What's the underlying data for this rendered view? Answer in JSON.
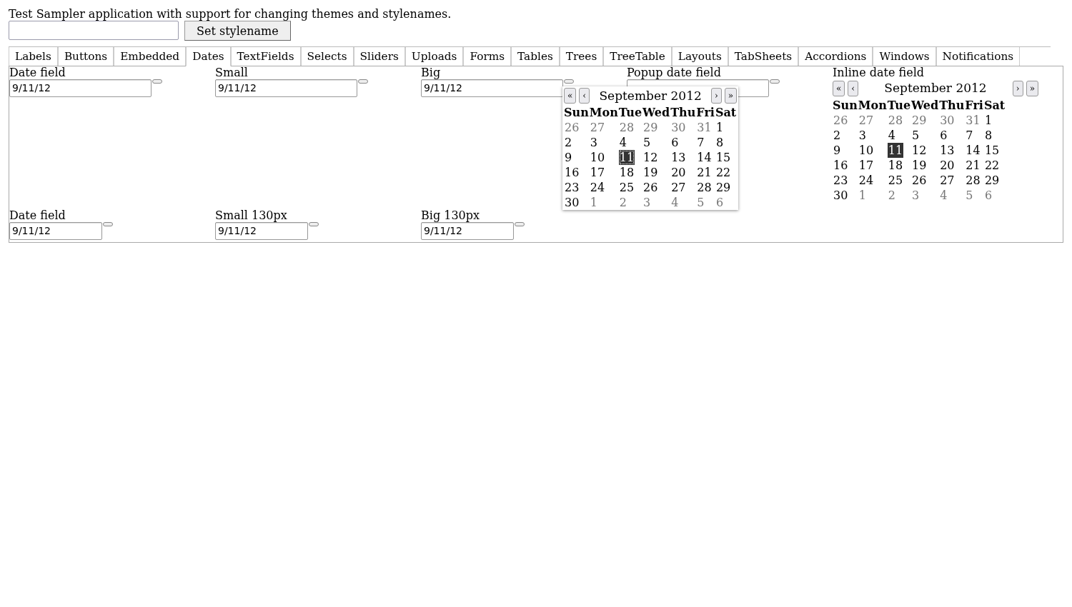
{
  "header": {
    "text": "Test Sampler application with support for changing themes and stylenames."
  },
  "stylename": {
    "button": "Set stylename"
  },
  "tabs": [
    {
      "label": "Labels",
      "selected": false
    },
    {
      "label": "Buttons",
      "selected": false
    },
    {
      "label": "Embedded",
      "selected": false
    },
    {
      "label": "Dates",
      "selected": true
    },
    {
      "label": "TextFields",
      "selected": false
    },
    {
      "label": "Selects",
      "selected": false
    },
    {
      "label": "Sliders",
      "selected": false
    },
    {
      "label": "Uploads",
      "selected": false
    },
    {
      "label": "Forms",
      "selected": false
    },
    {
      "label": "Tables",
      "selected": false
    },
    {
      "label": "Trees",
      "selected": false
    },
    {
      "label": "TreeTable",
      "selected": false
    },
    {
      "label": "Layouts",
      "selected": false
    },
    {
      "label": "TabSheets",
      "selected": false
    },
    {
      "label": "Accordions",
      "selected": false
    },
    {
      "label": "Windows",
      "selected": false
    },
    {
      "label": "Notifications",
      "selected": false
    }
  ],
  "rows": [
    {
      "fields": [
        {
          "label": "Date field",
          "value": "9/11/12",
          "kind": "wide"
        },
        {
          "label": "Small",
          "value": "9/11/12",
          "kind": "wide"
        },
        {
          "label": "Big",
          "value": "9/11/12",
          "kind": "wide"
        },
        {
          "label": "Popup date field",
          "kind": "wide"
        }
      ],
      "inline": {
        "label": "Inline date field",
        "calendar": {
          "title": "September 2012",
          "nav": [
            "«",
            "‹",
            "›",
            "»"
          ],
          "weekdays": [
            "Sun",
            "Mon",
            "Tue",
            "Wed",
            "Thu",
            "Fri",
            "Sat"
          ],
          "weeks": [
            [
              {
                "d": "26",
                "other": true
              },
              {
                "d": "27",
                "other": true
              },
              {
                "d": "28",
                "other": true
              },
              {
                "d": "29",
                "other": true
              },
              {
                "d": "30",
                "other": true
              },
              {
                "d": "31",
                "other": true
              },
              {
                "d": "1",
                "other": false
              }
            ],
            [
              {
                "d": "2",
                "other": false
              },
              {
                "d": "3",
                "other": false
              },
              {
                "d": "4",
                "other": false
              },
              {
                "d": "5",
                "other": false
              },
              {
                "d": "6",
                "other": false
              },
              {
                "d": "7",
                "other": false
              },
              {
                "d": "8",
                "other": false
              }
            ],
            [
              {
                "d": "9",
                "other": false
              },
              {
                "d": "10",
                "other": false
              },
              {
                "d": "11",
                "other": false,
                "selected": true
              },
              {
                "d": "12",
                "other": false
              },
              {
                "d": "13",
                "other": false
              },
              {
                "d": "14",
                "other": false
              },
              {
                "d": "15",
                "other": false
              }
            ],
            [
              {
                "d": "16",
                "other": false
              },
              {
                "d": "17",
                "other": false
              },
              {
                "d": "18",
                "other": false
              },
              {
                "d": "19",
                "other": false
              },
              {
                "d": "20",
                "other": false
              },
              {
                "d": "21",
                "other": false
              },
              {
                "d": "22",
                "other": false
              }
            ],
            [
              {
                "d": "23",
                "other": false
              },
              {
                "d": "24",
                "other": false
              },
              {
                "d": "25",
                "other": false
              },
              {
                "d": "26",
                "other": false
              },
              {
                "d": "27",
                "other": false
              },
              {
                "d": "28",
                "other": false
              },
              {
                "d": "29",
                "other": false
              }
            ],
            [
              {
                "d": "30",
                "other": false
              },
              {
                "d": "1",
                "other": true
              },
              {
                "d": "2",
                "other": true
              },
              {
                "d": "3",
                "other": true
              },
              {
                "d": "4",
                "other": true
              },
              {
                "d": "5",
                "other": true
              },
              {
                "d": "6",
                "other": true
              }
            ]
          ]
        }
      }
    },
    {
      "fields": [
        {
          "label": "Date field",
          "value": "9/11/12",
          "kind": "narrow"
        },
        {
          "label": "Small 130px",
          "value": "9/11/12",
          "kind": "narrow"
        },
        {
          "label": "Big 130px",
          "value": "9/11/12",
          "kind": "narrow"
        }
      ]
    }
  ],
  "popup": {
    "title": "September 2012",
    "nav": [
      "«",
      "‹",
      "›",
      "»"
    ],
    "weekdays": [
      "Sun",
      "Mon",
      "Tue",
      "Wed",
      "Thu",
      "Fri",
      "Sat"
    ],
    "weeks": [
      [
        {
          "d": "26",
          "other": true
        },
        {
          "d": "27",
          "other": true
        },
        {
          "d": "28",
          "other": true
        },
        {
          "d": "29",
          "other": true
        },
        {
          "d": "30",
          "other": true
        },
        {
          "d": "31",
          "other": true
        },
        {
          "d": "1",
          "other": false
        }
      ],
      [
        {
          "d": "2",
          "other": false
        },
        {
          "d": "3",
          "other": false
        },
        {
          "d": "4",
          "other": false
        },
        {
          "d": "5",
          "other": false
        },
        {
          "d": "6",
          "other": false
        },
        {
          "d": "7",
          "other": false
        },
        {
          "d": "8",
          "other": false
        }
      ],
      [
        {
          "d": "9",
          "other": false
        },
        {
          "d": "10",
          "other": false
        },
        {
          "d": "11",
          "other": false,
          "selected": true
        },
        {
          "d": "12",
          "other": false
        },
        {
          "d": "13",
          "other": false
        },
        {
          "d": "14",
          "other": false
        },
        {
          "d": "15",
          "other": false
        }
      ],
      [
        {
          "d": "16",
          "other": false
        },
        {
          "d": "17",
          "other": false
        },
        {
          "d": "18",
          "other": false
        },
        {
          "d": "19",
          "other": false
        },
        {
          "d": "20",
          "other": false
        },
        {
          "d": "21",
          "other": false
        },
        {
          "d": "22",
          "other": false
        }
      ],
      [
        {
          "d": "23",
          "other": false
        },
        {
          "d": "24",
          "other": false
        },
        {
          "d": "25",
          "other": false
        },
        {
          "d": "26",
          "other": false
        },
        {
          "d": "27",
          "other": false
        },
        {
          "d": "28",
          "other": false
        },
        {
          "d": "29",
          "other": false
        }
      ],
      [
        {
          "d": "30",
          "other": false
        },
        {
          "d": "1",
          "other": true
        },
        {
          "d": "2",
          "other": true
        },
        {
          "d": "3",
          "other": true
        },
        {
          "d": "4",
          "other": true
        },
        {
          "d": "5",
          "other": true
        },
        {
          "d": "6",
          "other": true
        }
      ]
    ]
  }
}
